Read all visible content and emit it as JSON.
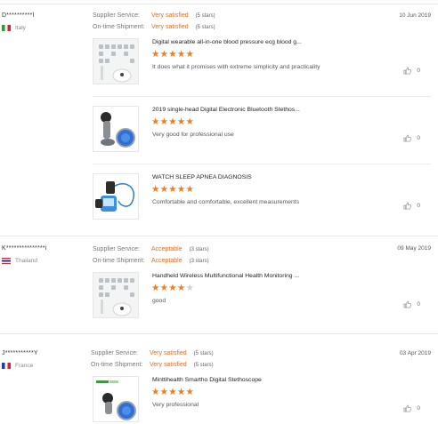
{
  "labels": {
    "supplier_service": "Supplier Service:",
    "on_time_shipment": "On-time Shipment:"
  },
  "reviews": [
    {
      "buyer": "D**********l",
      "country": "Italy",
      "date": "10 Jun 2019",
      "supplier_service": "Very satisfied",
      "supplier_service_stars": "(5 stars)",
      "shipment": "Very satisfied",
      "shipment_stars": "(5 stars)",
      "products": [
        {
          "title": "Digital wearable all-in-one blood pressure ecg blood g...",
          "rating": 5,
          "comment": "It does what it promises with extreme simplicity and practicality",
          "helpful_count": "0"
        },
        {
          "title": "2019 single-head Digital Electronic Bluetooth Stethos...",
          "rating": 5,
          "comment": "Very good for professional use",
          "helpful_count": "0"
        },
        {
          "title": "WATCH SLEEP APNEA DIAGNOSIS",
          "rating": 5,
          "comment": "Comfortable and comfortable, excellent measurements",
          "helpful_count": "0"
        }
      ]
    },
    {
      "buyer": "K***************i",
      "country": "Thailand",
      "date": "09 May 2019",
      "supplier_service": "Acceptable",
      "supplier_service_stars": "(3 stars)",
      "shipment": "Acceptable",
      "shipment_stars": "(3 stars)",
      "products": [
        {
          "title": "Handheld Wireless Multifunctional Health Monitoring ...",
          "rating": 4,
          "comment": "good",
          "helpful_count": "0"
        }
      ]
    },
    {
      "buyer": "J***********Y",
      "country": "France",
      "date": "03 Apr 2019",
      "supplier_service": "Very satisfied",
      "supplier_service_stars": "(5 stars)",
      "shipment": "Very satisfied",
      "shipment_stars": "(5 stars)",
      "products": [
        {
          "title": "Minttihealth Smartho Digital Stethoscope",
          "rating": 5,
          "comment": "Very professional",
          "helpful_count": "0"
        }
      ]
    }
  ],
  "colors": {
    "accent": "#e66a1e",
    "star_on": "#f07c1d",
    "star_off": "#cfcfcf"
  },
  "icons": {
    "helpful": "thumbs-up-icon"
  }
}
